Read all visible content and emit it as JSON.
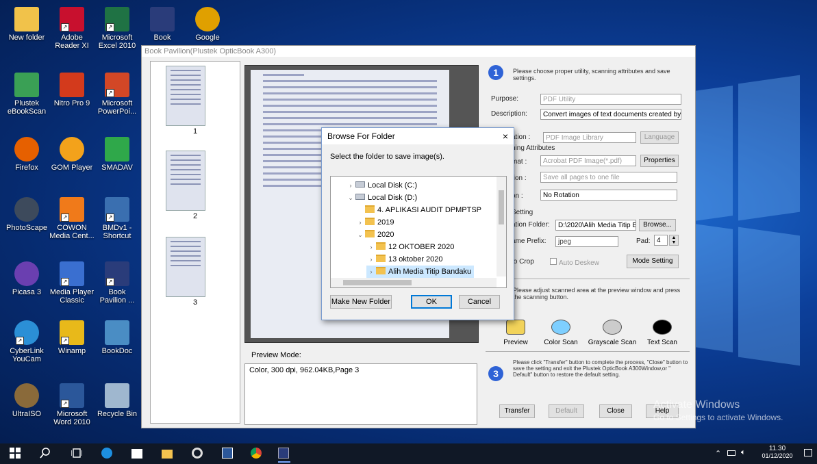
{
  "desktop_icons": [
    {
      "label": "New folder",
      "icon": "folder-icon",
      "color": "#f1c24a"
    },
    {
      "label": "Adobe Reader XI",
      "icon": "adobe-reader-icon",
      "color": "#c8102e"
    },
    {
      "label": "Microsoft Excel 2010",
      "icon": "excel-icon",
      "color": "#1f7244"
    },
    {
      "label": "Book Pavilion",
      "icon": "book-pavilion-icon",
      "color": "#2a3c7a"
    },
    {
      "label": "Google Chrome",
      "icon": "chrome-icon",
      "color": "#e0a000"
    },
    {
      "label": "Plustek eBookScan",
      "icon": "plustek-icon",
      "color": "#3aa055"
    },
    {
      "label": "Nitro Pro 9",
      "icon": "nitro-icon",
      "color": "#d33a1c"
    },
    {
      "label": "Microsoft PowerPoi...",
      "icon": "powerpoint-icon",
      "color": "#d24726"
    },
    {
      "label": "Firefox",
      "icon": "firefox-icon",
      "color": "#e66000"
    },
    {
      "label": "GOM Player",
      "icon": "gom-player-icon",
      "color": "#f3a21b"
    },
    {
      "label": "SMADAV",
      "icon": "smadav-icon",
      "color": "#2fa84a"
    },
    {
      "label": "PhotoScape",
      "icon": "photoscape-icon",
      "color": "#3d4a5c"
    },
    {
      "label": "COWON Media Cent...",
      "icon": "cowon-icon",
      "color": "#f07a1a"
    },
    {
      "label": "BMDv1 - Shortcut",
      "icon": "bmd-icon",
      "color": "#3a6fb0"
    },
    {
      "label": "Picasa 3",
      "icon": "picasa-icon",
      "color": "#6a3fb0"
    },
    {
      "label": "Media Player Classic",
      "icon": "media-player-icon",
      "color": "#3a6fd0"
    },
    {
      "label": "Book Pavilion ...",
      "icon": "book-pavilion-icon",
      "color": "#2a3c7a"
    },
    {
      "label": "CyberLink YouCam",
      "icon": "youcam-icon",
      "color": "#2b8fd6"
    },
    {
      "label": "Winamp",
      "icon": "winamp-icon",
      "color": "#e8b91a"
    },
    {
      "label": "BookDoc",
      "icon": "bookdoc-icon",
      "color": "#4a8dc4"
    },
    {
      "label": "UltraISO",
      "icon": "ultraiso-icon",
      "color": "#8a6a3a"
    },
    {
      "label": "Microsoft Word 2010",
      "icon": "word-icon",
      "color": "#2b579a"
    },
    {
      "label": "Recycle Bin",
      "icon": "recycle-bin-icon",
      "color": "#9fb7cf"
    }
  ],
  "app": {
    "title": "Book Pavilion(Plustek OpticBook A300)",
    "thumb_numbers": [
      "1",
      "2",
      "3"
    ],
    "preview_mode_label": "Preview Mode:",
    "info_text": "Color,  300 dpi,  962.04KB,Page 3",
    "step1_text": "Please choose proper utility, scanning attributes and save settings.",
    "purpose_label": "Purpose:",
    "purpose_value": "PDF Utility",
    "description_label": "Description:",
    "description_value": "Convert images of text documents created by the",
    "application_label": "ation :",
    "application_value": "PDF Image Library",
    "language_button": "Language",
    "scanning_attributes_label": "ning Attributes",
    "format_label": "mat :",
    "format_value": "Acrobat PDF Image(*.pdf)",
    "properties_button": "Properties",
    "page_label": "tion :",
    "page_value": "Save all pages to one file",
    "rotation_label": "on :",
    "rotation_value": "No Rotation",
    "setting_label": "Setting",
    "destination_label": "ation Folder:",
    "destination_value": "D:\\2020\\Alih Media Titip B:",
    "browse_button": "Browse...",
    "prefix_label": "ame Prefix:",
    "prefix_value": "jpeg",
    "pad_label": "Pad:",
    "pad_value": "4",
    "auto_crop_label": "to Crop",
    "auto_deskew_label": "Auto Deskew",
    "mode_setting_button": "Mode Setting",
    "step2_text": "Please adjust scanned area at the preview window and press the scanning button.",
    "scan_buttons": [
      "Preview",
      "Color Scan",
      "Grayscale Scan",
      "Text Scan"
    ],
    "step3_text": "Please click \"Transfer\" button to complete the process, \"Close\" button to save the setting and exit the Plustek OpticBook A300Window,or \" Default\" button to restore the default setting.",
    "transfer_button": "Transfer",
    "default_button": "Default",
    "close_button": "Close",
    "help_button": "Help"
  },
  "dialog": {
    "title": "Browse For Folder",
    "close": "×",
    "prompt": "Select the folder to save image(s).",
    "tree": [
      {
        "label": "Local Disk (C:)",
        "chevron": "›",
        "type": "drive",
        "indent": 0,
        "selected": false
      },
      {
        "label": "Local Disk (D:)",
        "chevron": "⌄",
        "type": "drive",
        "indent": 0,
        "selected": false
      },
      {
        "label": "4. APLIKASI AUDIT DPMPTSP",
        "chevron": "",
        "type": "folder",
        "indent": 1,
        "selected": false
      },
      {
        "label": "2019",
        "chevron": "›",
        "type": "folder",
        "indent": 1,
        "selected": false
      },
      {
        "label": "2020",
        "chevron": "⌄",
        "type": "folder",
        "indent": 1,
        "selected": false
      },
      {
        "label": "12 OKTOBER 2020",
        "chevron": "›",
        "type": "folder",
        "indent": 2,
        "selected": false
      },
      {
        "label": "13 oktober 2020",
        "chevron": "›",
        "type": "folder",
        "indent": 2,
        "selected": false
      },
      {
        "label": "Alih Media Titip Bandaku",
        "chevron": "›",
        "type": "folder",
        "indent": 2,
        "selected": true
      }
    ],
    "make_new_folder": "Make New Folder",
    "ok": "OK",
    "cancel": "Cancel"
  },
  "watermark": {
    "line1": "Activate Windows",
    "line2": "Go to Settings to activate Windows."
  },
  "taskbar": {
    "items": [
      "start-icon",
      "search-icon",
      "task-view-icon",
      "edge-icon",
      "store-icon",
      "file-explorer-icon",
      "photoscape-icon",
      "word-icon",
      "chrome-icon",
      "book-pavilion-icon"
    ],
    "time": "11.30",
    "date": "01/12/2020"
  }
}
